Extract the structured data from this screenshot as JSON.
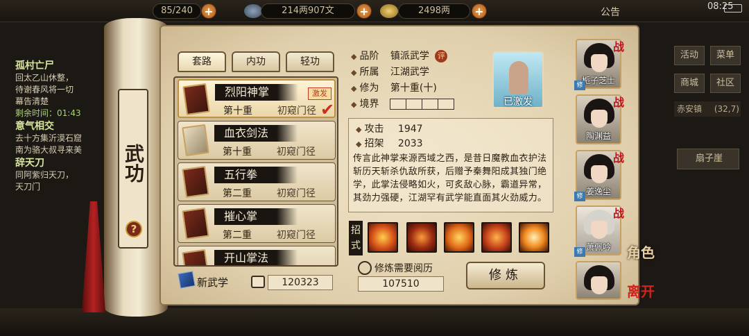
{
  "topbar": {
    "stamina": "85/240",
    "copper": "214两907文",
    "silver": "2498两",
    "notice": "公告",
    "time": "08:25"
  },
  "quest_panel": {
    "q1_title": "孤村亡尸",
    "q1_lines": [
      "回太乙山休整，",
      "待谢春风将一切",
      "幕告清楚"
    ],
    "q1_timer": "剩余时间：01:43",
    "q2_title": "意气相交",
    "q2_lines": [
      "去十方集沂漠石窟",
      "南为骆大叔寻来美"
    ],
    "q3_title": "辞天刀",
    "q3_lines": [
      "同阿紫归天刀，",
      "天刀门"
    ]
  },
  "right_menu": {
    "activity": "活动",
    "city": "商城",
    "item_a": "菜单",
    "community": "社区",
    "location": "赤安镇",
    "coords": "(32,7)",
    "place": "扇子崖"
  },
  "scroll": {
    "title": "武功",
    "help": "?"
  },
  "tabs": [
    "套路",
    "内功",
    "轻功"
  ],
  "skills": [
    {
      "name": "烈阳神掌",
      "level": "第十重",
      "stage": "初窥门径",
      "badge": "激发"
    },
    {
      "name": "血衣剑法",
      "level": "第十重",
      "stage": "初窥门径"
    },
    {
      "name": "五行拳",
      "level": "第二重",
      "stage": "初窥门径"
    },
    {
      "name": "摧心掌",
      "level": "第二重",
      "stage": "初窥门径"
    },
    {
      "name": "开山掌法",
      "level": "",
      "stage": ""
    }
  ],
  "bottom_left": {
    "new_label": "新武学",
    "exp_points": "120323"
  },
  "detail": {
    "grade_label": "品阶",
    "grade_value": "镇派武学",
    "grade_pin": "评",
    "sect_label": "所属",
    "sect_value": "江湖武学",
    "level_label": "修为",
    "level_value": "第十重(十)",
    "realm_label": "境界",
    "portrait_label": "已激发",
    "attack_label": "攻击",
    "attack_value": "1947",
    "parry_label": "招架",
    "parry_value": "2033",
    "description": "传言此神掌来源西域之西，是昔日魔教血衣护法斩历天斩杀仇敌所获，后赠予秦舞阳成其独门绝学，此掌法侵略如火，可炙敌心脉，霸道异常，其劲力强硬，江湖罕有武学能直面其火劲威力。",
    "moves_label": "招式",
    "moves_label_a": "招",
    "moves_label_b": "式",
    "req_label": "修炼需要阅历",
    "req_value": "107510",
    "train_button": "修炼"
  },
  "characters": [
    {
      "name": "栀子芝士",
      "war": "战",
      "xiu": "修"
    },
    {
      "name": "陶渊益",
      "war": "战"
    },
    {
      "name": "姜逸尘",
      "war": "战",
      "xiu": "修"
    },
    {
      "name": "萧佩吟",
      "war": "战",
      "xiu": "修"
    },
    {
      "name": ""
    }
  ],
  "side_buttons": {
    "role": "角色",
    "leave": "离开"
  },
  "colors": {
    "paper": "#e4d6b7",
    "accent_red": "#c0151a",
    "ink": "#1a1510"
  }
}
